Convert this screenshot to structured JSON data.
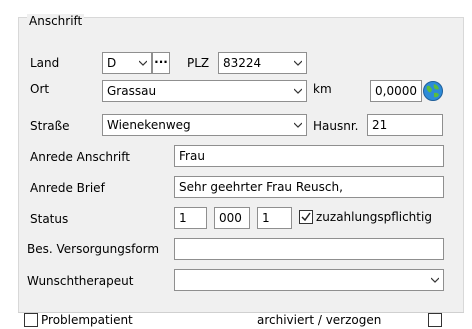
{
  "section": {
    "title": "Anschrift"
  },
  "land": {
    "label": "Land",
    "value": "D",
    "plz_label": "PLZ",
    "plz_value": "83224",
    "dots_label": "···"
  },
  "ort": {
    "label": "Ort",
    "value": "Grassau",
    "km_label": "km",
    "km_value": "0,0000"
  },
  "strasse": {
    "label": "Straße",
    "value": "Wienekenweg",
    "hausnr_label": "Hausnr.",
    "hausnr_value": "21"
  },
  "anrede_anschrift": {
    "label": "Anrede Anschrift",
    "value": "Frau"
  },
  "anrede_brief": {
    "label": "Anrede Brief",
    "value": "Sehr geehrter Frau Reusch,"
  },
  "status": {
    "label": "Status",
    "value1": "1",
    "value2": "000",
    "value3": "1",
    "zuzahlung_label": "zuzahlungspflichtig",
    "zuzahlung_checked": true
  },
  "versorgungsform": {
    "label": "Bes. Versorgungsform",
    "value": ""
  },
  "wunschtherapeut": {
    "label": "Wunschtherapeut",
    "value": ""
  },
  "problempatient": {
    "label": "Problempatient",
    "checked": false
  },
  "archiviert": {
    "label": "archiviert / verzogen",
    "checked": false
  }
}
